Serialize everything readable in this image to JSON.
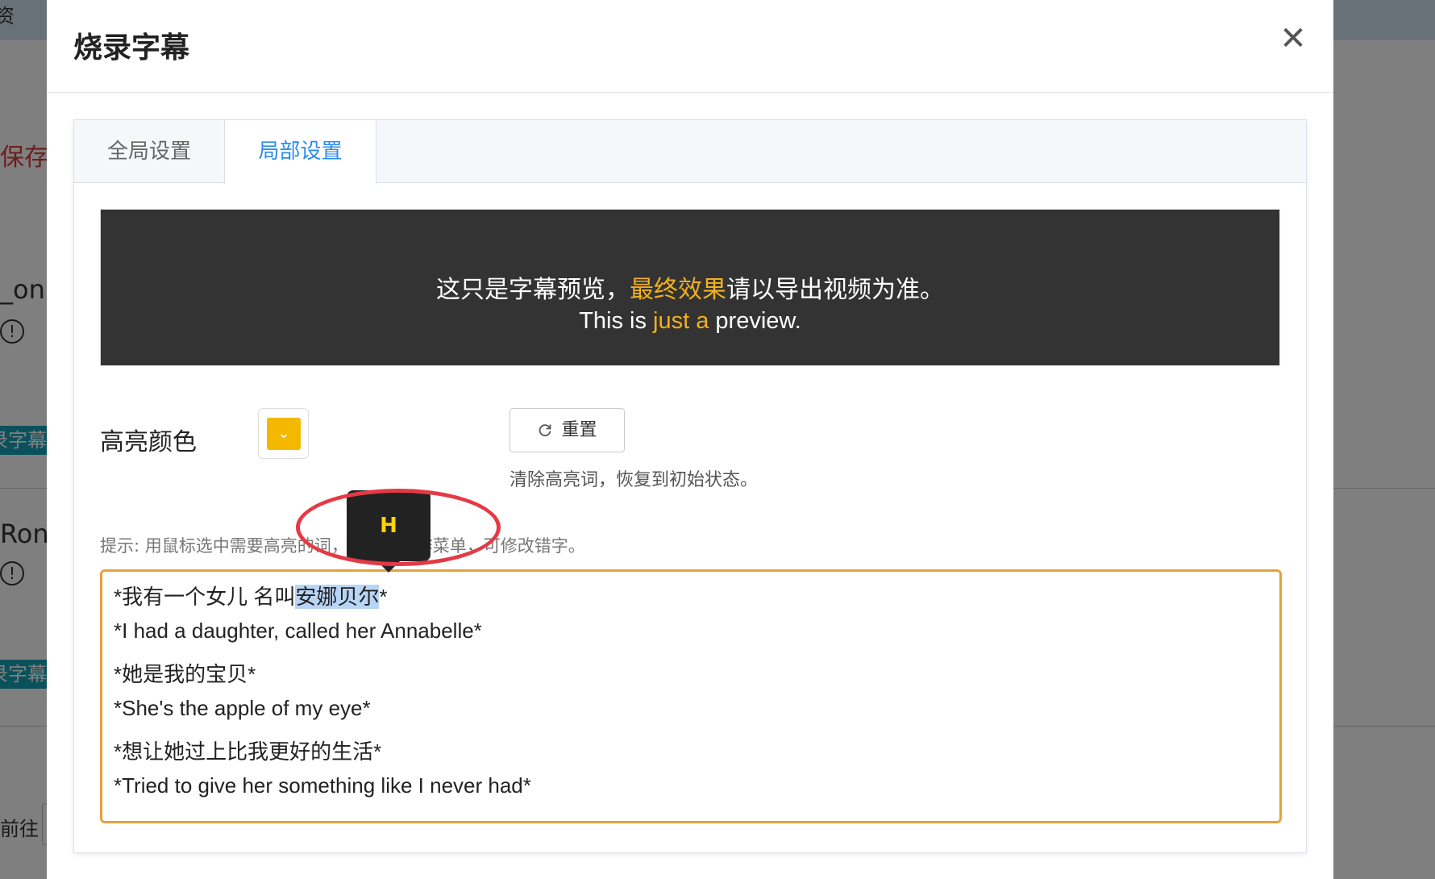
{
  "background": {
    "topbar_text": "资",
    "save_label": "保存",
    "item1_name": "_on",
    "item2_name": "Ron_",
    "alert_glyph": "!",
    "item_button": "录字幕",
    "goto_label": "前往"
  },
  "modal": {
    "title": "烧录字幕",
    "close_glyph": "✕"
  },
  "tabs": [
    {
      "label": "全局设置",
      "active": false
    },
    {
      "label": "局部设置",
      "active": true
    }
  ],
  "preview": {
    "line1_before": "这只是字幕预览，",
    "line1_highlight": "最终效果",
    "line1_after": "请以导出视频为准。",
    "line2_before": "This is ",
    "line2_highlight": "just a",
    "line2_after": " preview."
  },
  "highlight": {
    "label": "高亮颜色",
    "color": "#f5b800",
    "dropdown_glyph": "⌄",
    "reset_label": "重置",
    "reset_icon": "refresh-icon",
    "reset_hint": "清除高亮词，恢复到初始状态。"
  },
  "tip": "提示: 用鼠标选中需要高亮的词，会出现操作菜单，可修改错字。",
  "subtitles": [
    {
      "zh_before": "*我有一个女儿 名叫",
      "zh_selected": "安娜贝尔",
      "zh_after": "*",
      "en": "*I had a daughter, called her Annabelle*"
    },
    {
      "zh": "*她是我的宝贝*",
      "en": "*She's the apple of my eye*"
    },
    {
      "zh": "*想让她过上比我更好的生活*",
      "en": "*Tried to give her something like I never had*"
    }
  ],
  "popup": {
    "label": "H"
  },
  "colors": {
    "accent": "#2d8cf0",
    "editor_border": "#e6a23c",
    "highlight_text": "#f0b020",
    "annotation": "#e63946"
  }
}
